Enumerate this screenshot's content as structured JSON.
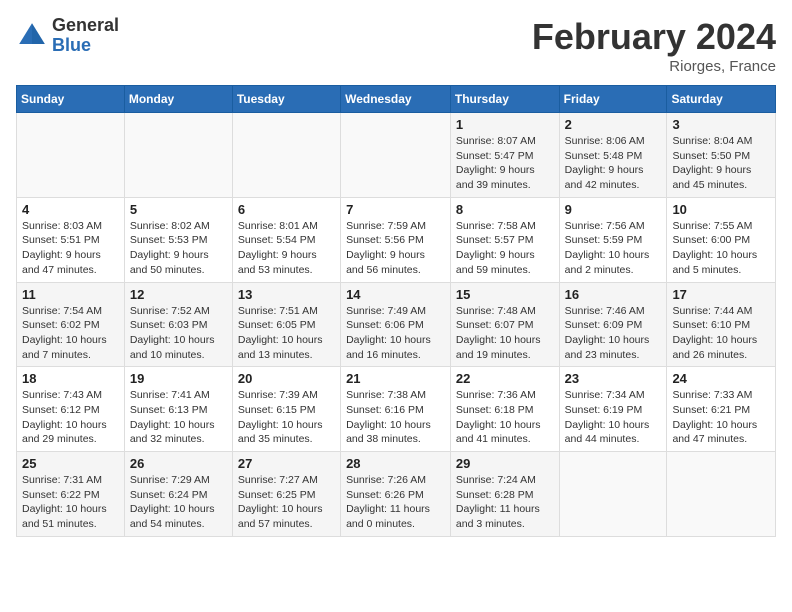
{
  "header": {
    "logo_general": "General",
    "logo_blue": "Blue",
    "month_title": "February 2024",
    "location": "Riorges, France"
  },
  "days_of_week": [
    "Sunday",
    "Monday",
    "Tuesday",
    "Wednesday",
    "Thursday",
    "Friday",
    "Saturday"
  ],
  "weeks": [
    [
      {
        "day": "",
        "info": ""
      },
      {
        "day": "",
        "info": ""
      },
      {
        "day": "",
        "info": ""
      },
      {
        "day": "",
        "info": ""
      },
      {
        "day": "1",
        "info": "Sunrise: 8:07 AM\nSunset: 5:47 PM\nDaylight: 9 hours\nand 39 minutes."
      },
      {
        "day": "2",
        "info": "Sunrise: 8:06 AM\nSunset: 5:48 PM\nDaylight: 9 hours\nand 42 minutes."
      },
      {
        "day": "3",
        "info": "Sunrise: 8:04 AM\nSunset: 5:50 PM\nDaylight: 9 hours\nand 45 minutes."
      }
    ],
    [
      {
        "day": "4",
        "info": "Sunrise: 8:03 AM\nSunset: 5:51 PM\nDaylight: 9 hours\nand 47 minutes."
      },
      {
        "day": "5",
        "info": "Sunrise: 8:02 AM\nSunset: 5:53 PM\nDaylight: 9 hours\nand 50 minutes."
      },
      {
        "day": "6",
        "info": "Sunrise: 8:01 AM\nSunset: 5:54 PM\nDaylight: 9 hours\nand 53 minutes."
      },
      {
        "day": "7",
        "info": "Sunrise: 7:59 AM\nSunset: 5:56 PM\nDaylight: 9 hours\nand 56 minutes."
      },
      {
        "day": "8",
        "info": "Sunrise: 7:58 AM\nSunset: 5:57 PM\nDaylight: 9 hours\nand 59 minutes."
      },
      {
        "day": "9",
        "info": "Sunrise: 7:56 AM\nSunset: 5:59 PM\nDaylight: 10 hours\nand 2 minutes."
      },
      {
        "day": "10",
        "info": "Sunrise: 7:55 AM\nSunset: 6:00 PM\nDaylight: 10 hours\nand 5 minutes."
      }
    ],
    [
      {
        "day": "11",
        "info": "Sunrise: 7:54 AM\nSunset: 6:02 PM\nDaylight: 10 hours\nand 7 minutes."
      },
      {
        "day": "12",
        "info": "Sunrise: 7:52 AM\nSunset: 6:03 PM\nDaylight: 10 hours\nand 10 minutes."
      },
      {
        "day": "13",
        "info": "Sunrise: 7:51 AM\nSunset: 6:05 PM\nDaylight: 10 hours\nand 13 minutes."
      },
      {
        "day": "14",
        "info": "Sunrise: 7:49 AM\nSunset: 6:06 PM\nDaylight: 10 hours\nand 16 minutes."
      },
      {
        "day": "15",
        "info": "Sunrise: 7:48 AM\nSunset: 6:07 PM\nDaylight: 10 hours\nand 19 minutes."
      },
      {
        "day": "16",
        "info": "Sunrise: 7:46 AM\nSunset: 6:09 PM\nDaylight: 10 hours\nand 23 minutes."
      },
      {
        "day": "17",
        "info": "Sunrise: 7:44 AM\nSunset: 6:10 PM\nDaylight: 10 hours\nand 26 minutes."
      }
    ],
    [
      {
        "day": "18",
        "info": "Sunrise: 7:43 AM\nSunset: 6:12 PM\nDaylight: 10 hours\nand 29 minutes."
      },
      {
        "day": "19",
        "info": "Sunrise: 7:41 AM\nSunset: 6:13 PM\nDaylight: 10 hours\nand 32 minutes."
      },
      {
        "day": "20",
        "info": "Sunrise: 7:39 AM\nSunset: 6:15 PM\nDaylight: 10 hours\nand 35 minutes."
      },
      {
        "day": "21",
        "info": "Sunrise: 7:38 AM\nSunset: 6:16 PM\nDaylight: 10 hours\nand 38 minutes."
      },
      {
        "day": "22",
        "info": "Sunrise: 7:36 AM\nSunset: 6:18 PM\nDaylight: 10 hours\nand 41 minutes."
      },
      {
        "day": "23",
        "info": "Sunrise: 7:34 AM\nSunset: 6:19 PM\nDaylight: 10 hours\nand 44 minutes."
      },
      {
        "day": "24",
        "info": "Sunrise: 7:33 AM\nSunset: 6:21 PM\nDaylight: 10 hours\nand 47 minutes."
      }
    ],
    [
      {
        "day": "25",
        "info": "Sunrise: 7:31 AM\nSunset: 6:22 PM\nDaylight: 10 hours\nand 51 minutes."
      },
      {
        "day": "26",
        "info": "Sunrise: 7:29 AM\nSunset: 6:24 PM\nDaylight: 10 hours\nand 54 minutes."
      },
      {
        "day": "27",
        "info": "Sunrise: 7:27 AM\nSunset: 6:25 PM\nDaylight: 10 hours\nand 57 minutes."
      },
      {
        "day": "28",
        "info": "Sunrise: 7:26 AM\nSunset: 6:26 PM\nDaylight: 11 hours\nand 0 minutes."
      },
      {
        "day": "29",
        "info": "Sunrise: 7:24 AM\nSunset: 6:28 PM\nDaylight: 11 hours\nand 3 minutes."
      },
      {
        "day": "",
        "info": ""
      },
      {
        "day": "",
        "info": ""
      }
    ]
  ]
}
